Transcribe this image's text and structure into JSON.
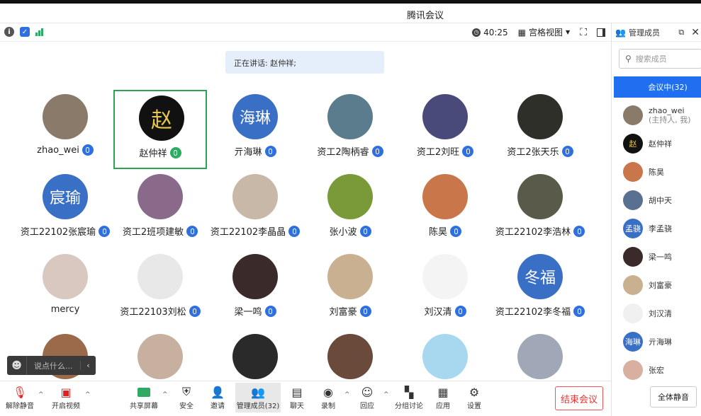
{
  "window": {
    "title": "腾讯会议"
  },
  "toolbar": {
    "timer": "40:25",
    "view_label": "宫格视图"
  },
  "speaking": {
    "label": "正在讲话: 赵仲祥;"
  },
  "tiles": [
    {
      "name": "zhao_wei",
      "avatar_text": "",
      "color": "#8a7a6a"
    },
    {
      "name": "赵仲祥",
      "avatar_text": "赵",
      "color": "#111111"
    },
    {
      "name": "亓海琳",
      "avatar_text": "海琳",
      "color": "#3a6fc6"
    },
    {
      "name": "资工2陶柄睿",
      "avatar_text": "",
      "color": "#5a7c8c"
    },
    {
      "name": "资工2刘旺",
      "avatar_text": "",
      "color": "#4a4a7a"
    },
    {
      "name": "资工2张天乐",
      "avatar_text": "",
      "color": "#2f2f2a"
    },
    {
      "name": "资工22102张宸瑜",
      "avatar_text": "宸瑜",
      "color": "#3a6fc6"
    },
    {
      "name": "资工2班项建敏",
      "avatar_text": "",
      "color": "#8a6a8a"
    },
    {
      "name": "资工22102李晶晶",
      "avatar_text": "",
      "color": "#c8b8a8"
    },
    {
      "name": "张小波",
      "avatar_text": "",
      "color": "#7a9a3a"
    },
    {
      "name": "陈昊",
      "avatar_text": "",
      "color": "#c8764a"
    },
    {
      "name": "资工22102李浩林",
      "avatar_text": "",
      "color": "#5a5a4a"
    },
    {
      "name": "mercy",
      "avatar_text": "",
      "color": "#d8c8c0"
    },
    {
      "name": "资工22103刘松",
      "avatar_text": "",
      "color": "#e8e8e8"
    },
    {
      "name": "梁一鸣",
      "avatar_text": "",
      "color": "#3a2a2a"
    },
    {
      "name": "刘富豪",
      "avatar_text": "",
      "color": "#c8b090"
    },
    {
      "name": "刘汉清",
      "avatar_text": "",
      "color": "#f4f4f4"
    },
    {
      "name": "资工22102李冬福",
      "avatar_text": "冬福",
      "color": "#3a6fc6"
    },
    {
      "name": "",
      "avatar_text": "",
      "color": "#9a6a4a"
    },
    {
      "name": "",
      "avatar_text": "",
      "color": "#c8b0a0"
    },
    {
      "name": "",
      "avatar_text": "",
      "color": "#2a2a2a"
    },
    {
      "name": "",
      "avatar_text": "",
      "color": "#6a4a3a"
    },
    {
      "name": "",
      "avatar_text": "",
      "color": "#a8d8f0"
    },
    {
      "name": "",
      "avatar_text": "",
      "color": "#a0a8b8"
    }
  ],
  "chat": {
    "placeholder": "说点什么..."
  },
  "bottombar": {
    "unmute": "解除静音",
    "start_video": "开启视频",
    "share_screen": "共享屏幕",
    "security": "安全",
    "invite": "邀请",
    "manage_members": "管理成员(32)",
    "chat": "聊天",
    "record": "录制",
    "reactions": "回应",
    "breakout": "分组讨论",
    "apps": "应用",
    "settings": "设置",
    "end_meeting": "结束会议"
  },
  "panel": {
    "title": "管理成员",
    "search_placeholder": "搜索成员",
    "tab_in_meeting": "会议中(32)",
    "members": [
      {
        "name": "zhao_wei",
        "sub": "(主持人, 我)",
        "avatar_text": "",
        "color": "#8a7a6a"
      },
      {
        "name": "赵仲祥",
        "sub": "",
        "avatar_text": "赵",
        "color": "#111111"
      },
      {
        "name": "陈昊",
        "sub": "",
        "avatar_text": "",
        "color": "#c8764a"
      },
      {
        "name": "胡中天",
        "sub": "",
        "avatar_text": "",
        "color": "#5a7090"
      },
      {
        "name": "李孟骁",
        "sub": "",
        "avatar_text": "孟骁",
        "color": "#3a6fc6"
      },
      {
        "name": "梁一鸣",
        "sub": "",
        "avatar_text": "",
        "color": "#3a2a2a"
      },
      {
        "name": "刘富豪",
        "sub": "",
        "avatar_text": "",
        "color": "#c8b090"
      },
      {
        "name": "刘汉清",
        "sub": "",
        "avatar_text": "",
        "color": "#f0f0f0"
      },
      {
        "name": "亓海琳",
        "sub": "",
        "avatar_text": "海琳",
        "color": "#3a6fc6"
      },
      {
        "name": "张宏",
        "sub": "",
        "avatar_text": "",
        "color": "#d8b0a0"
      }
    ],
    "mute_all": "全体静音"
  }
}
